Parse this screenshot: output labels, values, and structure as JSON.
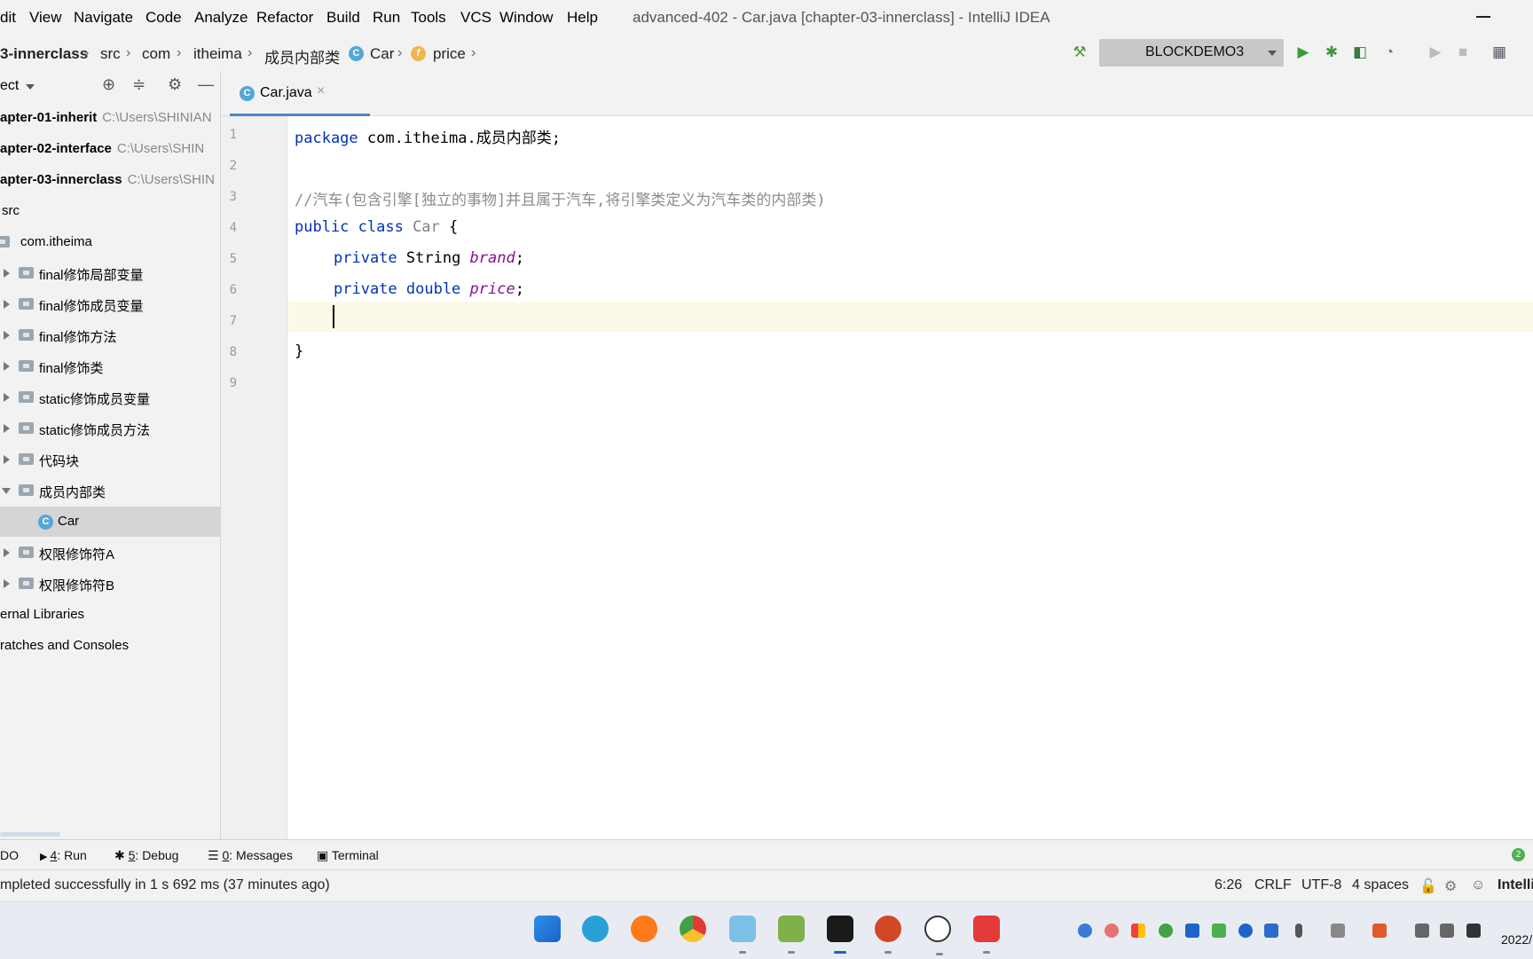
{
  "menu": {
    "items": [
      {
        "label": "dit"
      },
      {
        "label": "View"
      },
      {
        "label": "Navigate"
      },
      {
        "label": "Code"
      },
      {
        "label": "Analyze"
      },
      {
        "label": "Refactor"
      },
      {
        "label": "Build"
      },
      {
        "label": "Run"
      },
      {
        "label": "Tools"
      },
      {
        "label": "VCS"
      },
      {
        "label": "Window"
      },
      {
        "label": "Help"
      }
    ],
    "window_title": "advanced-402 - Car.java [chapter-03-innerclass] - IntelliJ IDEA"
  },
  "breadcrumb": {
    "items": [
      "3-innerclass",
      "src",
      "com",
      "itheima",
      "成员内部类",
      "Car",
      "price"
    ]
  },
  "toolbar": {
    "run_config": "BLOCKDEMO3",
    "icons": [
      "build-hammer-icon",
      "run-icon",
      "debug-icon",
      "coverage-icon",
      "profile-icon",
      "stop-icon",
      "project-structure-icon"
    ]
  },
  "project_panel": {
    "title": "ect",
    "tree": [
      {
        "label": "apter-01-inherit",
        "path": "C:\\Users\\SHINIAN"
      },
      {
        "label": "apter-02-interface",
        "path": "C:\\Users\\SHIN"
      },
      {
        "label": "apter-03-innerclass",
        "path": "C:\\Users\\SHIN"
      },
      {
        "label": "src"
      },
      {
        "label": "com.itheima"
      },
      {
        "label": "final修饰局部变量"
      },
      {
        "label": "final修饰成员变量"
      },
      {
        "label": "final修饰方法"
      },
      {
        "label": "final修饰类"
      },
      {
        "label": "static修饰成员变量"
      },
      {
        "label": "static修饰成员方法"
      },
      {
        "label": "代码块"
      },
      {
        "label": "成员内部类"
      },
      {
        "label": "Car"
      },
      {
        "label": "权限修饰符A"
      },
      {
        "label": "权限修饰符B"
      },
      {
        "label": "ernal Libraries"
      },
      {
        "label": "ratches and Consoles"
      }
    ]
  },
  "editor": {
    "tab_label": "Car.java",
    "line_numbers": [
      "1",
      "2",
      "3",
      "4",
      "5",
      "6",
      "7",
      "8",
      "9"
    ],
    "code": {
      "l1_kw": "package",
      "l1_rest": " com.itheima.成员内部类;",
      "l3_comment": "//汽车(包含引擎[独立的事物]并且属于汽车,将引擎类定义为汽车类的内部类)",
      "l4_kw": "public class ",
      "l4_cls": "Car",
      "l4_rest": " {",
      "l5_kw": "private ",
      "l5_type": "String ",
      "l5_field": "brand",
      "l5_semi": ";",
      "l6_kw": "private double ",
      "l6_field": "price",
      "l6_semi": ";",
      "l8": "}"
    }
  },
  "tool_tabs": {
    "todo": "DO",
    "run_num": "4",
    "run_label": ": Run",
    "debug_num": "5",
    "debug_label": ": Debug",
    "messages_num": "0",
    "messages_label": ": Messages",
    "terminal": "Terminal",
    "event_count": "2"
  },
  "status": {
    "message": "mpleted successfully in 1 s 692 ms (37 minutes ago)",
    "position": "6:26",
    "line_sep": "CRLF",
    "encoding": "UTF-8",
    "indent": "4 spaces",
    "brand": "Intelli"
  },
  "taskbar": {
    "clock": "2022/"
  }
}
